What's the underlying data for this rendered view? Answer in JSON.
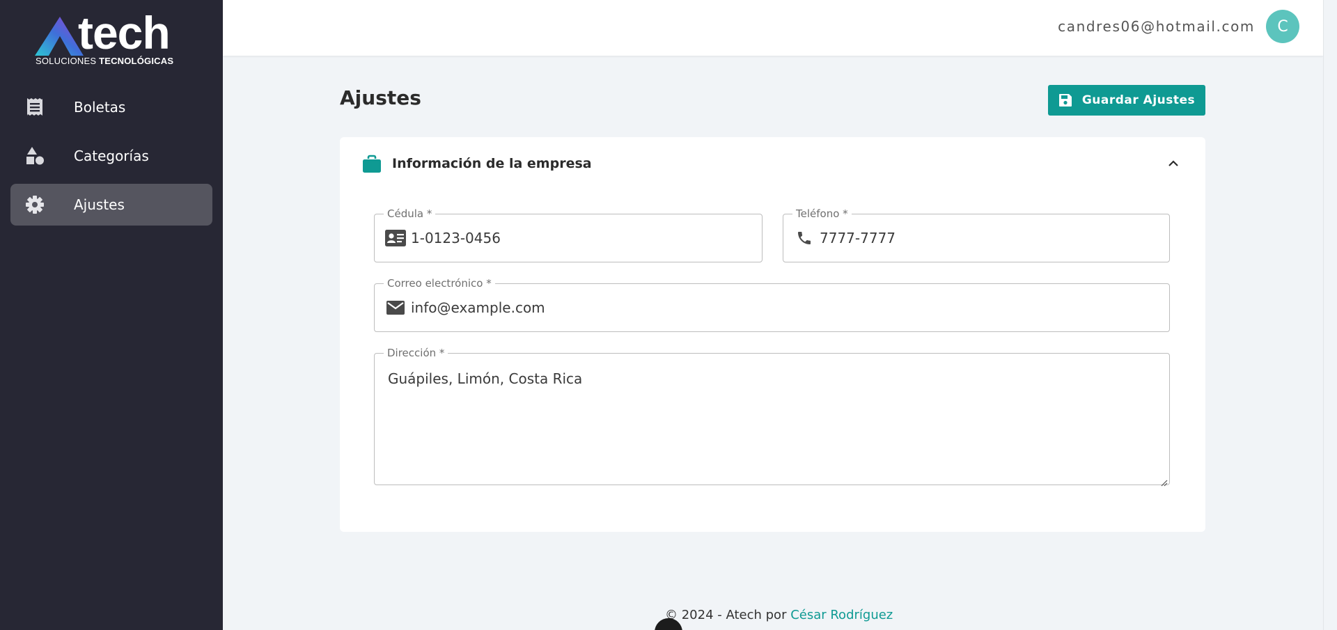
{
  "brand": {
    "logo_word": "Atech",
    "logo_letters": "tech",
    "tagline_light": "SOLUCIONES ",
    "tagline_bold": "TECNOLÓGICAS"
  },
  "sidebar": {
    "items": [
      {
        "label": "Boletas",
        "icon": "receipt-icon",
        "active": false
      },
      {
        "label": "Categorías",
        "icon": "shapes-icon",
        "active": false
      },
      {
        "label": "Ajustes",
        "icon": "gear-icon",
        "active": true
      }
    ]
  },
  "header": {
    "user_email": "candres06@hotmail.com",
    "avatar_initial": "C"
  },
  "main": {
    "title": "Ajustes",
    "save_label": "Guardar Ajustes"
  },
  "card": {
    "title": "Información de la empresa",
    "fields": {
      "cedula": {
        "label": "Cédula *",
        "value": "1-0123-0456",
        "icon": "id-card-icon"
      },
      "telefono": {
        "label": "Teléfono *",
        "value": "7777-7777",
        "icon": "phone-icon"
      },
      "correo": {
        "label": "Correo electrónico *",
        "value": "info@example.com",
        "icon": "mail-icon"
      },
      "direccion": {
        "label": "Dirección *",
        "value": "Guápiles, Limón, Costa Rica"
      }
    }
  },
  "footer": {
    "text": "© 2024 - Atech por ",
    "author": "César Rodríguez"
  },
  "colors": {
    "sidebar_bg": "#272734",
    "accent": "#0f9a93",
    "avatar": "#5cc4bd",
    "page_bg": "#f1f4f7"
  }
}
